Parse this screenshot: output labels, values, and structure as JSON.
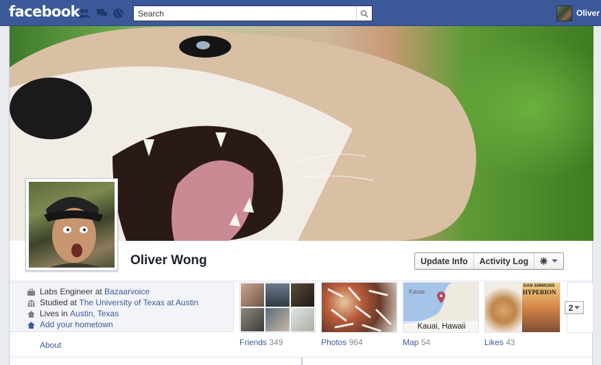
{
  "header": {
    "logo": "facebook",
    "search": {
      "placeholder": "Search"
    },
    "user_name": "Oliver",
    "icons": [
      "friends-icon",
      "messages-icon",
      "notifications-globe-icon",
      "search-icon"
    ]
  },
  "profile": {
    "name": "Oliver Wong",
    "buttons": {
      "update_info": "Update Info",
      "activity_log": "Activity Log",
      "settings_icon": "gear-icon"
    }
  },
  "about": {
    "work_prefix": "Labs Engineer at ",
    "work_link": "Bazaarvoice",
    "school_prefix": "Studied at ",
    "school_link": "The University of Texas at Austin",
    "lives_prefix": "Lives in ",
    "lives_link": "Austin, Texas",
    "hometown_link": "Add your hometown",
    "about_link": "About"
  },
  "apps": {
    "friends": {
      "label": "Friends",
      "count": "349"
    },
    "photos": {
      "label": "Photos",
      "count": "964"
    },
    "map": {
      "label": "Map",
      "count": "54",
      "place_top": "Kauai",
      "place_caption": "Kauai, Hawaii"
    },
    "likes": {
      "label": "Likes",
      "count": "43",
      "book_title": "DAN SIMMONS",
      "book_subtitle": "HYPERION"
    },
    "more_count": "2"
  },
  "colors": {
    "brand": "#3b5998",
    "link": "#3b5998",
    "page_bg": "#e9ebee"
  }
}
